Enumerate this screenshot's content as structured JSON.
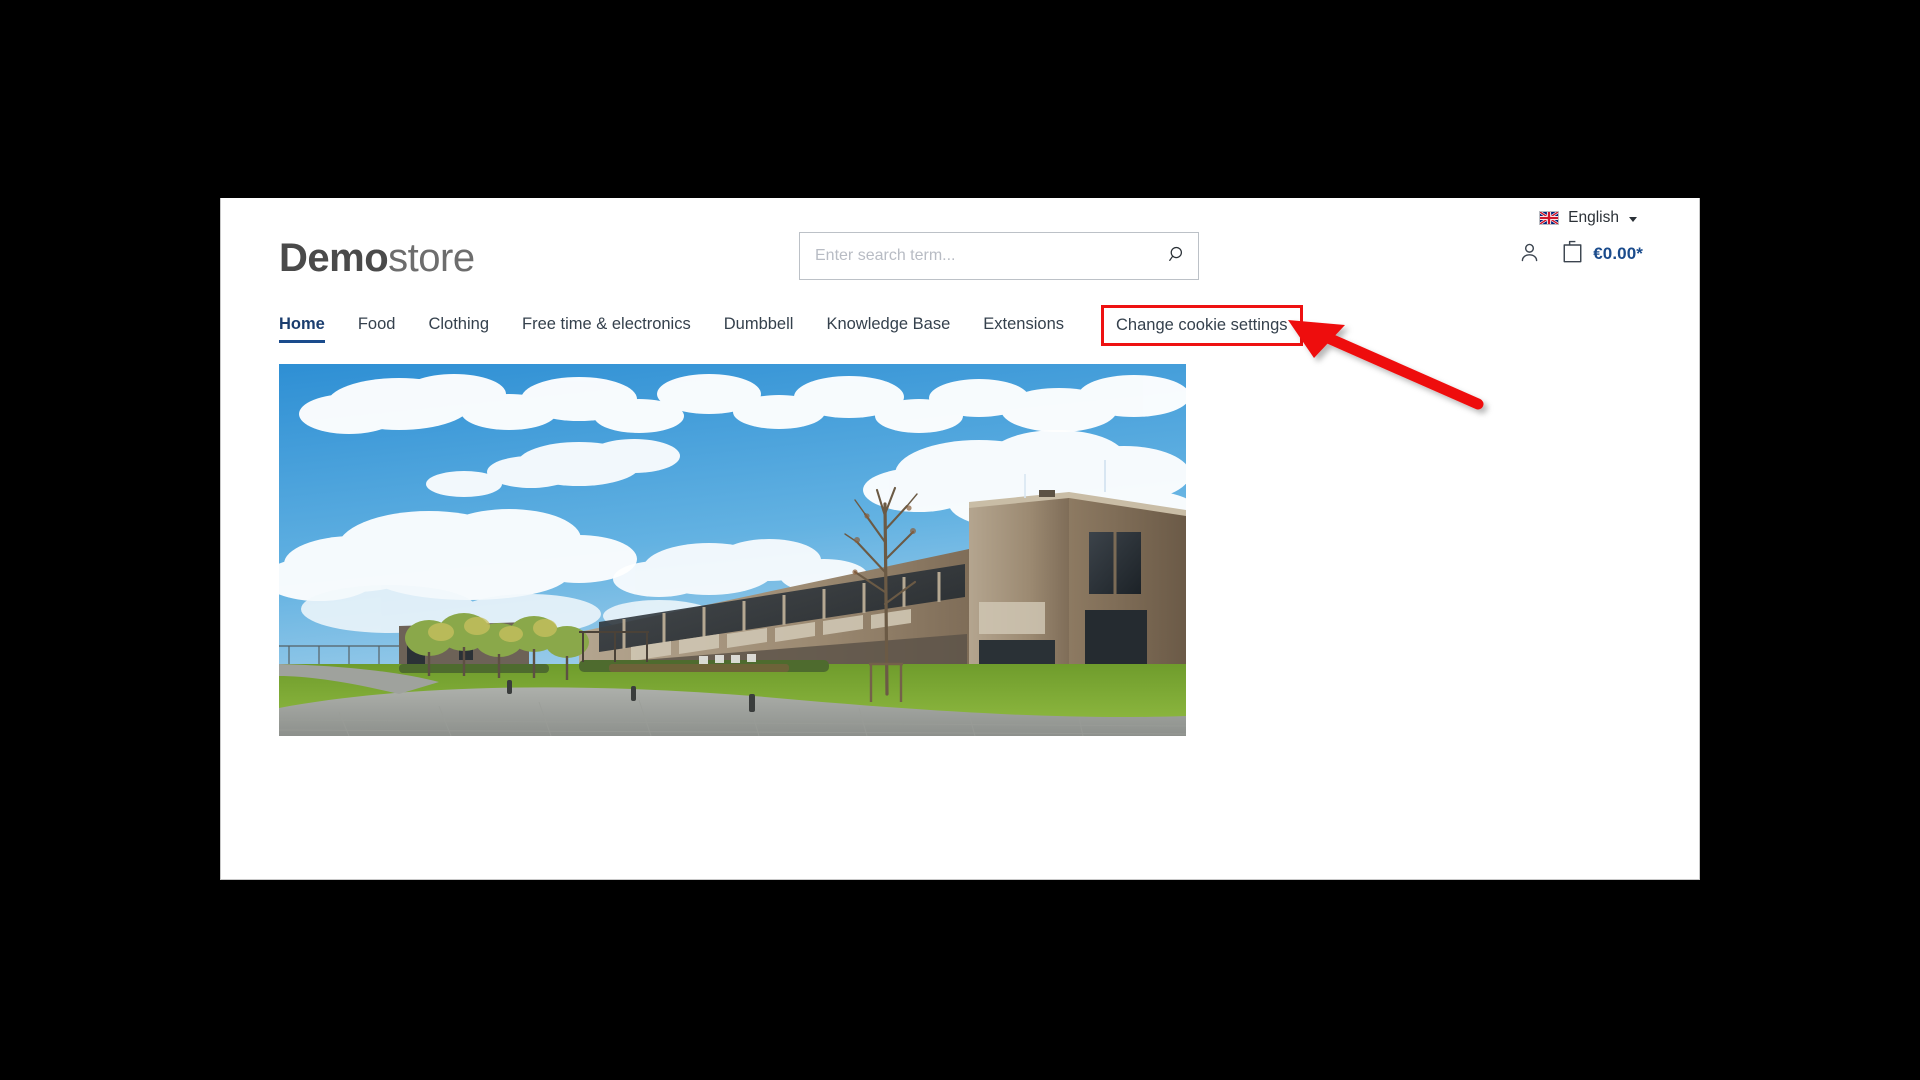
{
  "page": {
    "site_name_bold": "Demo",
    "site_name_light": "store"
  },
  "topbar": {
    "language": {
      "label": "English",
      "flag": "uk-flag-icon",
      "caret": "chevron-down-icon"
    }
  },
  "search": {
    "placeholder": "Enter search term...",
    "value": "",
    "submit_icon": "search-icon"
  },
  "account": {
    "user_icon": "user-icon",
    "cart_icon": "shopping-bag-icon",
    "cart_total": "€0.00*"
  },
  "nav": {
    "items": [
      {
        "label": "Home",
        "active": true,
        "highlighted": false
      },
      {
        "label": "Food",
        "active": false,
        "highlighted": false
      },
      {
        "label": "Clothing",
        "active": false,
        "highlighted": false
      },
      {
        "label": "Free time & electronics",
        "active": false,
        "highlighted": false
      },
      {
        "label": "Dumbbell",
        "active": false,
        "highlighted": false
      },
      {
        "label": "Knowledge Base",
        "active": false,
        "highlighted": false
      },
      {
        "label": "Extensions",
        "active": false,
        "highlighted": false
      },
      {
        "label": "Change cookie settings",
        "active": false,
        "highlighted": true
      }
    ]
  },
  "hero": {
    "alt": "Modern wooden office building with lawn, young trees and paved plaza under a blue sky with cumulus clouds"
  },
  "annotation": {
    "type": "arrow",
    "color": "#ee1111",
    "points_to": "Change cookie settings",
    "highlight_box_color": "#ee1111"
  },
  "colors": {
    "background": "#000000",
    "page_background": "#ffffff",
    "accent_blue": "#1a4b8c",
    "text": "#35414d",
    "annotation_red": "#ee1111"
  }
}
